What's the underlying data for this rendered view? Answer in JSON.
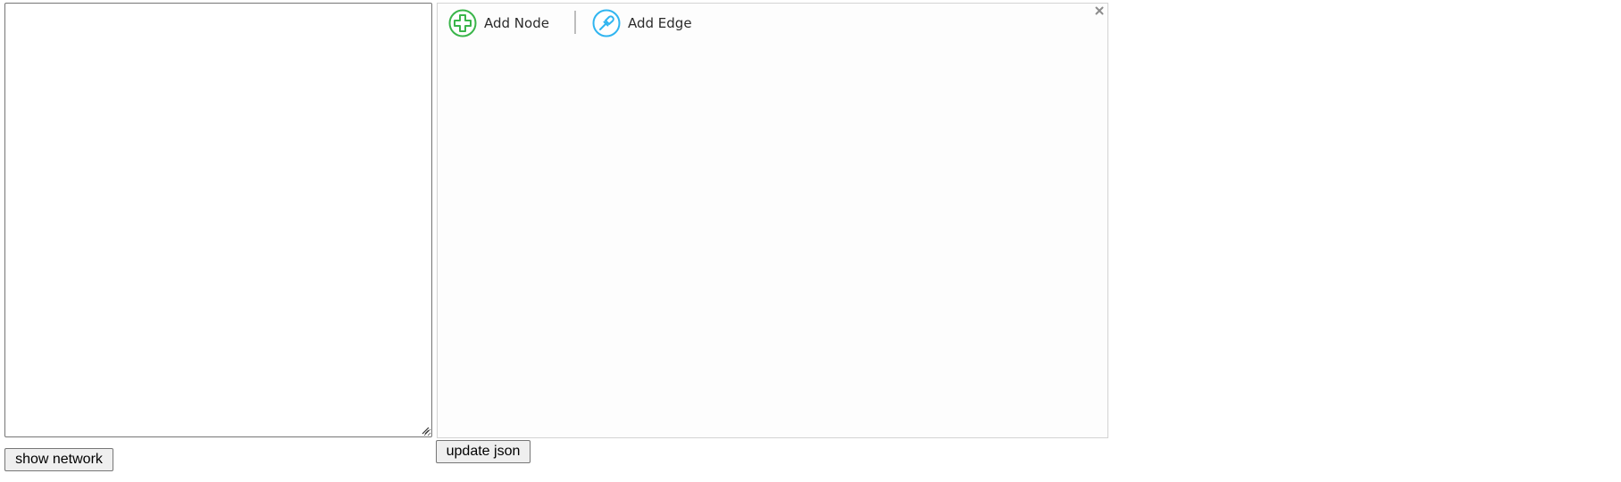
{
  "editor": {
    "json_text": "",
    "show_network_label": "show network"
  },
  "network": {
    "toolbar": {
      "add_node_label": "Add Node",
      "add_node_icon": "plus-circle-icon",
      "add_node_color": "#3ab54a",
      "add_edge_label": "Add Edge",
      "add_edge_icon": "connect-edge-icon",
      "add_edge_color": "#30b5f0"
    },
    "close_icon": "close-icon",
    "update_json_label": "update json"
  }
}
